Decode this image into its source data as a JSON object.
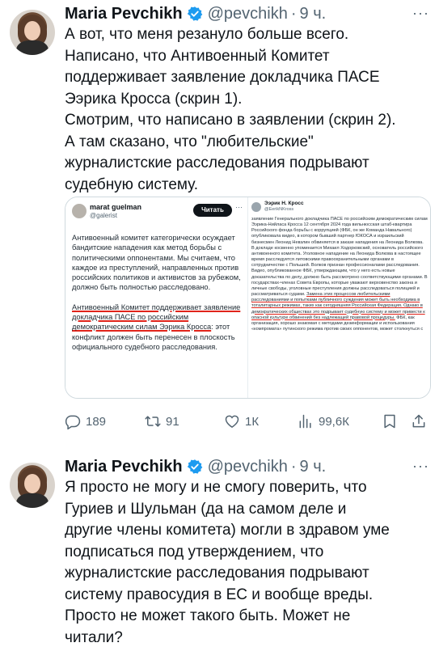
{
  "tweet1": {
    "author_name": "Maria Pevchikh",
    "author_handle": "@pevchikh",
    "dot": "·",
    "time": "9 ч.",
    "more": "···",
    "text_lines": [
      "А вот, что меня резануло больше всего.",
      "Написано, что Антивоенный Комитет",
      "поддерживает заявление докладчика ПАСЕ",
      "Ээрика Кросса (скрин 1).",
      "Смотрим, что написано в заявлении (скрин 2).",
      "А там сказано, что \"любительские\"",
      "журналистские расследования подрывают",
      "судебную систему."
    ],
    "screenshot1": {
      "name": "marat guelman",
      "handle": "@galerist",
      "follow_label": "Читать",
      "more": "···",
      "para1": "Антивоенный комитет категорически осуждает бандитские нападения как метод борьбы с политическими оппонентами. Мы считаем, что каждое из преступлений, направленных против российских политиков и активистов за рубежом, должно быть полностью расследовано.",
      "para2_highlight": "Антивоенный Комитет поддерживает заявление докладчика ПАСЕ по российским демократическим силам Ээрика Кросса",
      "para2_rest": ": этот конфликт должен быть перенесен в плоскость официального судебного расследования."
    },
    "screenshot2": {
      "name": "Ээрик Н. Кросс",
      "handle": "@EerikNKross",
      "text_before": "заявление Генерального докладчика ПАСЕ по российским демократическим силам Ээрика-Нийласа Кросса 12 сентября 2024 года вильнюсская штаб-квартира Российского фонда борьбы с коррупцией (ФБК, он же Команда Навального) опубликовала видео, в котором бывший партнер ЮКОСА и израильский бизнесмен Леонид Невзлин обвиняется в заказе нападения на Леонида Волкова. В докладе косвенно упоминается Михаил Ходорковский, основатель российского антивоенного комитета. Уголовное нападение на Леонида Волкова в настоящее время расследуется литовскими правоохранительными органами в сотрудничестве с Польшей. Волков признан профессионалами расследования. Видео, опубликованное ФБК, утверждающим, что у него есть новые доказательства по делу, должно быть рассмотрено соответствующими органами. В государствах-членах Совета Европы, которые уважают верховенство закона и личные свободы, уголовные преступления должны расследоваться полицией и рассматриваться судами. ",
      "text_highlight": "Замена этих процессов любительскими расследованиями и попытками публичного суждения может быть необходима в тоталитарных режимах, таких как сегодняшняя Российская Федерация. Однако в демократических обществах это подрывает судебную систему и может привести к опасной культуре обвинений без надлежащей правовой процедуры.",
      "text_after": " ФБК, как организация, хорошо знакомая с методами дезинформации и использования «компромата» путинского режима против своих оппонентов, может столкнуться с"
    },
    "actions": {
      "replies": "189",
      "retweets": "91",
      "likes": "1К",
      "views": "99,6К"
    }
  },
  "tweet2": {
    "author_name": "Maria Pevchikh",
    "author_handle": "@pevchikh",
    "dot": "·",
    "time": "9 ч.",
    "more": "···",
    "text_lines": [
      "Я просто не могу и не смогу поверить, что",
      "Гуриев и  Шульман (да на самом деле и",
      "другие члены комитета) могли в здравом уме",
      "подписаться под утверждением, что",
      "журналистские расследования подрывают",
      "систему правосудия в ЕС и вообще вреды.",
      "Просто не может такого быть. Может не",
      "читали?"
    ]
  },
  "colors": {
    "verified": "#1d9bf0",
    "text": "#0f1419",
    "secondary": "#536471",
    "highlight_underline": "#e0241b"
  }
}
